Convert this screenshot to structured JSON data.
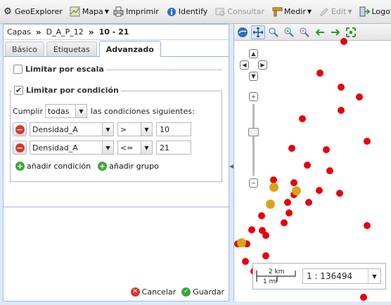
{
  "toolbar": {
    "app": "GeoExplorer",
    "map": "Mapa",
    "print": "Imprimir",
    "identify": "Identify",
    "query": "Consultar",
    "measure": "Medir",
    "edit": "Edit",
    "logout": "Logout, ar"
  },
  "breadcrumb": {
    "root": "Capas",
    "layer": "D_A_P_12",
    "rule": "10 - 21",
    "separator": "»"
  },
  "tabs": [
    "Básico",
    "Etiquetas",
    "Advanzado"
  ],
  "active_tab": "Advanzado",
  "scale_section": {
    "label": "Limitar por escala",
    "checked": false
  },
  "condition_section": {
    "label": "Limitar por condición",
    "checked": true,
    "check_mark": "✔",
    "match_prefix": "Cumplir",
    "match_value": "todas",
    "match_suffix": "las condiciones siguientes:",
    "remove_glyph": "−",
    "conditions": [
      {
        "field": "Densidad_A",
        "operator": ">",
        "value": "10"
      },
      {
        "field": "Densidad_A",
        "operator": "<=",
        "value": "21"
      }
    ],
    "add_glyph": "+",
    "add_condition": "añadir condición",
    "add_group": "añadir grupo"
  },
  "footer": {
    "cancel": "Cancelar",
    "save": "Guardar"
  },
  "map": {
    "scale_km": "2 km",
    "scale_mi": "1 mi",
    "scale_value": "1 : 136494",
    "pan_up": "▲",
    "pan_down": "▼",
    "pan_left": "◀",
    "pan_right": "▶",
    "zoom_in": "+",
    "zoom_out": "−",
    "point_color": "#e8000a",
    "selected_color": "#d9a41a"
  },
  "icons": {
    "app": "gear-icon",
    "map": "map-icon",
    "print": "printer-icon",
    "identify": "info-icon",
    "query": "query-icon",
    "measure": "ruler-icon",
    "edit": "pencil-icon",
    "logout": "logout-icon"
  }
}
